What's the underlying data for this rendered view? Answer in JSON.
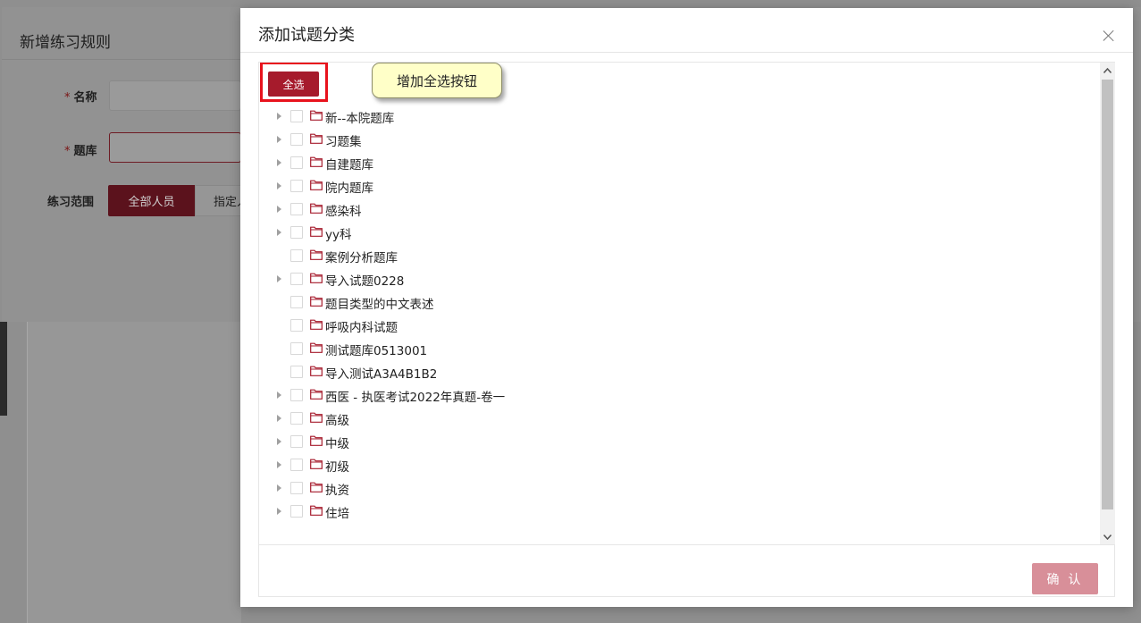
{
  "background_form": {
    "title": "新增练习规则",
    "fields": [
      {
        "label": "名称",
        "required": true
      },
      {
        "label": "题库",
        "required": true
      }
    ],
    "range_label": "练习范围",
    "range_options": [
      "全部人员",
      "指定人员"
    ],
    "range_selected": "全部人员",
    "required_mark": "*"
  },
  "modal": {
    "title": "添加试题分类",
    "select_all_label": "全选",
    "annotation": "增加全选按钮",
    "confirm_label": "确 认",
    "accent_color": "#a61b2c",
    "confirm_color": "#d88f99",
    "tree": [
      {
        "label": "新--本院题库",
        "expandable": true
      },
      {
        "label": "习题集",
        "expandable": true
      },
      {
        "label": "自建题库",
        "expandable": true
      },
      {
        "label": "院内题库",
        "expandable": true
      },
      {
        "label": "感染科",
        "expandable": true
      },
      {
        "label": "yy科",
        "expandable": true
      },
      {
        "label": "案例分析题库",
        "expandable": false
      },
      {
        "label": "导入试题0228",
        "expandable": true
      },
      {
        "label": "题目类型的中文表述",
        "expandable": false
      },
      {
        "label": "呼吸内科试题",
        "expandable": false
      },
      {
        "label": "测试题库0513001",
        "expandable": false
      },
      {
        "label": "导入测试A3A4B1B2",
        "expandable": false
      },
      {
        "label": "西医 - 执医考试2022年真题-卷一",
        "expandable": true
      },
      {
        "label": "高级",
        "expandable": true
      },
      {
        "label": "中级",
        "expandable": true
      },
      {
        "label": "初级",
        "expandable": true
      },
      {
        "label": "执资",
        "expandable": true
      },
      {
        "label": "住培",
        "expandable": true
      }
    ]
  }
}
